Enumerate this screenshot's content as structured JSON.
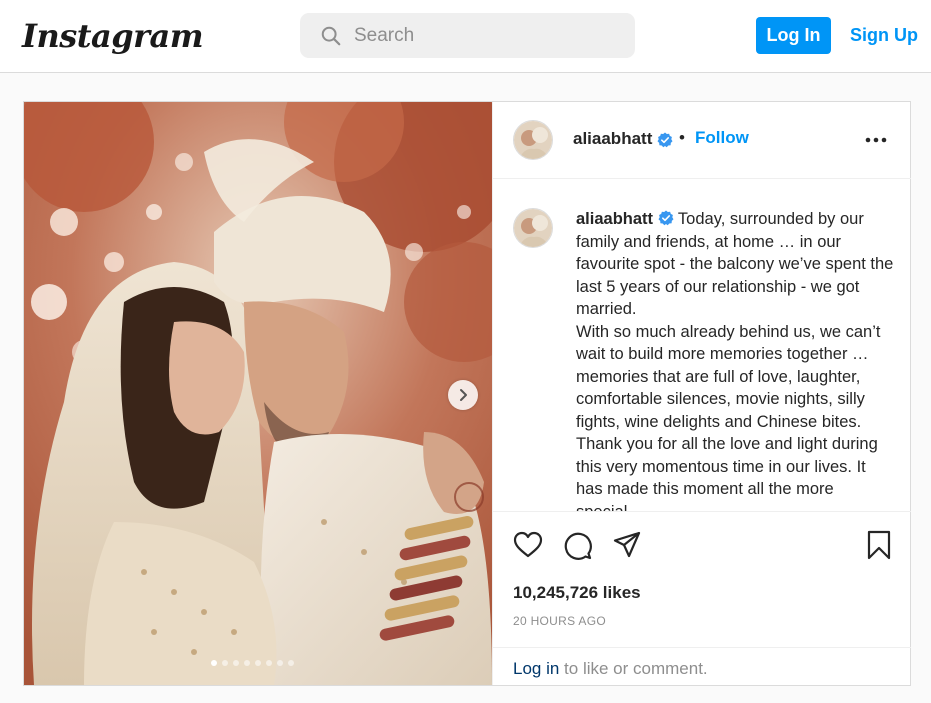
{
  "header": {
    "logo": "Instagram",
    "search_placeholder": "Search",
    "login_label": "Log In",
    "signup_label": "Sign Up"
  },
  "post": {
    "username": "aliaabhatt",
    "separator": "•",
    "follow_label": "Follow",
    "caption_lines": [
      "Today, surrounded by our family and friends, at home … in our favourite spot - the balcony we’ve spent the last 5 years of our relationship - we got married.",
      "With so much already behind us, we can’t wait to build more memories together … memories that are full of love, laughter, comfortable silences, movie nights, silly fights, wine delights and Chinese bites.",
      "Thank you for all the love and light during this very momentous time in our lives. It has made this moment all the more special."
    ],
    "likes": "10,245,726 likes",
    "timestamp": "20 HOURS AGO",
    "login_link": "Log in",
    "login_suffix": " to like or comment.",
    "carousel": {
      "count": 8,
      "active_index": 0
    }
  },
  "icons": {
    "search": "search-icon",
    "verified": "verified-badge-icon",
    "more": "more-options-icon",
    "like": "heart-icon",
    "comment": "comment-icon",
    "share": "share-icon",
    "save": "bookmark-icon",
    "next": "chevron-right-icon"
  },
  "colors": {
    "accent": "#0095f6",
    "text": "#262626",
    "muted": "#8e8e8e",
    "link_dark": "#00376b",
    "border": "#dbdbdb",
    "background": "#fafafa"
  }
}
